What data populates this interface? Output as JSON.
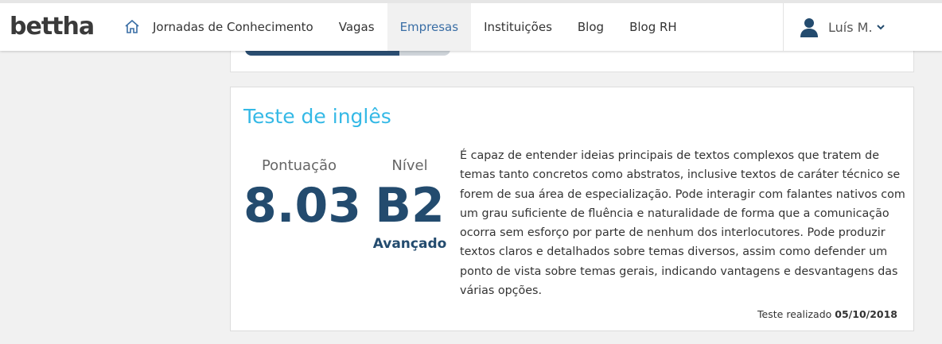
{
  "header": {
    "logo": "bettha",
    "nav": [
      {
        "label": "Jornadas de Conhecimento",
        "active": false
      },
      {
        "label": "Vagas",
        "active": false
      },
      {
        "label": "Empresas",
        "active": true
      },
      {
        "label": "Instituições",
        "active": false
      },
      {
        "label": "Blog",
        "active": false
      },
      {
        "label": "Blog RH",
        "active": false
      }
    ],
    "user_name": "Luís M."
  },
  "previous_card": {
    "progress_fraction": 0.75
  },
  "english_test": {
    "title": "Teste de inglês",
    "score_label": "Pontuação",
    "score_value": "8.03",
    "level_label": "Nível",
    "level_value": "B2",
    "level_description": "Avançado",
    "description": "É capaz de entender ideias principais de textos complexos que tratem de temas tanto concretos como abstratos, inclusive textos de caráter técnico se forem de sua área de especialização. Pode interagir com falantes nativos com um grau suficiente de fluência e naturalidade de forma que a comunicação ocorra sem esforço por parte de nenhum dos interlocutores. Pode produzir textos claros e detalhados sobre temas diversos, assim como defender um ponto de vista sobre temas gerais, indicando vantagens e desvantagens das várias opções.",
    "taken_label": "Teste realizado",
    "taken_date": "05/10/2018"
  },
  "colors": {
    "accent": "#35b9e6",
    "primary_dark": "#234b6e",
    "nav_active": "#3a6ea5"
  }
}
